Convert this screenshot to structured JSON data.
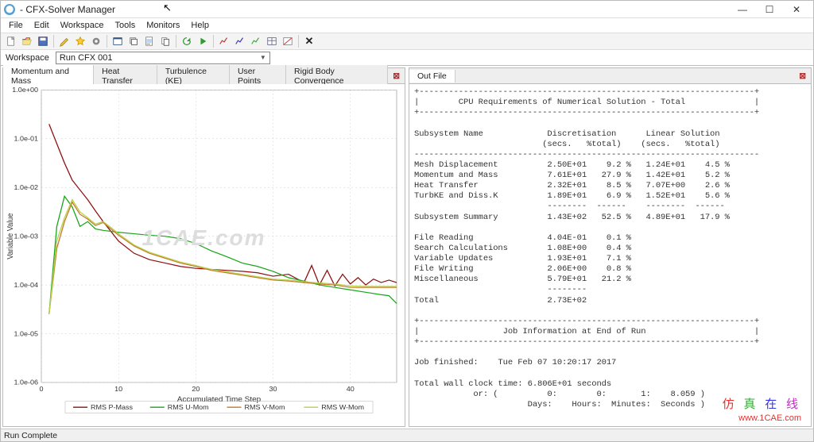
{
  "title": "- CFX-Solver Manager",
  "menus": [
    "File",
    "Edit",
    "Workspace",
    "Tools",
    "Monitors",
    "Help"
  ],
  "workspace": {
    "label": "Workspace",
    "value": "Run CFX 001"
  },
  "tabs": {
    "chart": [
      "Momentum and Mass",
      "Heat Transfer",
      "Turbulence (KE)",
      "User Points",
      "Rigid Body Convergence"
    ],
    "out": "Out File"
  },
  "status": "Run Complete",
  "chart_data": {
    "type": "line",
    "xlabel": "Accumulated Time Step",
    "ylabel": "Variable Value",
    "xlim": [
      0,
      46
    ],
    "ylim_log": [
      -6,
      0
    ],
    "x_ticks": [
      0,
      10,
      20,
      30,
      40
    ],
    "y_labels": [
      "1.0e+00",
      "1.0e-01",
      "1.0e-02",
      "1.0e-03",
      "1.0e-04",
      "1.0e-05",
      "1.0e-06"
    ],
    "series": [
      {
        "name": "RMS P-Mass",
        "color": "#8e0f10",
        "values": [
          [
            1,
            -0.7
          ],
          [
            2,
            -1.1
          ],
          [
            3,
            -1.5
          ],
          [
            4,
            -1.85
          ],
          [
            5,
            -2.05
          ],
          [
            6,
            -2.25
          ],
          [
            7,
            -2.48
          ],
          [
            8,
            -2.7
          ],
          [
            9,
            -2.9
          ],
          [
            10,
            -3.1
          ],
          [
            12,
            -3.35
          ],
          [
            14,
            -3.48
          ],
          [
            16,
            -3.55
          ],
          [
            18,
            -3.62
          ],
          [
            20,
            -3.66
          ],
          [
            22,
            -3.68
          ],
          [
            24,
            -3.7
          ],
          [
            26,
            -3.72
          ],
          [
            28,
            -3.75
          ],
          [
            30,
            -3.82
          ],
          [
            32,
            -3.78
          ],
          [
            34,
            -3.95
          ],
          [
            35,
            -3.6
          ],
          [
            36,
            -4.0
          ],
          [
            37,
            -3.7
          ],
          [
            38,
            -4.02
          ],
          [
            39,
            -3.78
          ],
          [
            40,
            -3.98
          ],
          [
            41,
            -3.85
          ],
          [
            42,
            -4.0
          ],
          [
            43,
            -3.88
          ],
          [
            44,
            -3.95
          ],
          [
            45,
            -3.9
          ],
          [
            46,
            -3.95
          ]
        ]
      },
      {
        "name": "RMS U-Mom",
        "color": "#1aa51a",
        "values": [
          [
            1,
            -4.6
          ],
          [
            2,
            -2.8
          ],
          [
            3,
            -2.18
          ],
          [
            4,
            -2.4
          ],
          [
            5,
            -2.8
          ],
          [
            6,
            -2.7
          ],
          [
            7,
            -2.85
          ],
          [
            8,
            -2.88
          ],
          [
            10,
            -2.92
          ],
          [
            12,
            -2.95
          ],
          [
            14,
            -2.98
          ],
          [
            16,
            -3.0
          ],
          [
            18,
            -3.05
          ],
          [
            20,
            -3.15
          ],
          [
            22,
            -3.3
          ],
          [
            24,
            -3.42
          ],
          [
            26,
            -3.55
          ],
          [
            28,
            -3.62
          ],
          [
            30,
            -3.72
          ],
          [
            32,
            -3.85
          ],
          [
            34,
            -3.92
          ],
          [
            36,
            -4.0
          ],
          [
            38,
            -4.05
          ],
          [
            40,
            -4.1
          ],
          [
            42,
            -4.15
          ],
          [
            44,
            -4.2
          ],
          [
            45,
            -4.22
          ],
          [
            46,
            -4.38
          ]
        ]
      },
      {
        "name": "RMS V-Mom",
        "color": "#c77825",
        "values": [
          [
            1,
            -4.6
          ],
          [
            2,
            -3.25
          ],
          [
            3,
            -2.7
          ],
          [
            4,
            -2.3
          ],
          [
            5,
            -2.55
          ],
          [
            6,
            -2.65
          ],
          [
            7,
            -2.78
          ],
          [
            8,
            -2.72
          ],
          [
            9,
            -2.85
          ],
          [
            10,
            -2.98
          ],
          [
            12,
            -3.2
          ],
          [
            14,
            -3.35
          ],
          [
            16,
            -3.45
          ],
          [
            18,
            -3.55
          ],
          [
            20,
            -3.62
          ],
          [
            22,
            -3.7
          ],
          [
            24,
            -3.75
          ],
          [
            26,
            -3.8
          ],
          [
            28,
            -3.85
          ],
          [
            30,
            -3.9
          ],
          [
            32,
            -3.92
          ],
          [
            34,
            -3.95
          ],
          [
            36,
            -3.98
          ],
          [
            38,
            -4.0
          ],
          [
            40,
            -4.05
          ],
          [
            42,
            -4.05
          ],
          [
            44,
            -4.05
          ],
          [
            46,
            -4.05
          ]
        ]
      },
      {
        "name": "RMS W-Mom",
        "color": "#b7d24a",
        "values": [
          [
            1,
            -4.6
          ],
          [
            2,
            -3.1
          ],
          [
            3,
            -2.62
          ],
          [
            4,
            -2.25
          ],
          [
            5,
            -2.5
          ],
          [
            6,
            -2.62
          ],
          [
            7,
            -2.75
          ],
          [
            8,
            -2.7
          ],
          [
            9,
            -2.82
          ],
          [
            10,
            -2.95
          ],
          [
            12,
            -3.18
          ],
          [
            14,
            -3.33
          ],
          [
            16,
            -3.43
          ],
          [
            18,
            -3.53
          ],
          [
            20,
            -3.6
          ],
          [
            22,
            -3.68
          ],
          [
            24,
            -3.73
          ],
          [
            26,
            -3.78
          ],
          [
            28,
            -3.83
          ],
          [
            30,
            -3.88
          ],
          [
            32,
            -3.9
          ],
          [
            34,
            -3.93
          ],
          [
            36,
            -3.96
          ],
          [
            38,
            -3.98
          ],
          [
            40,
            -4.02
          ],
          [
            42,
            -4.03
          ],
          [
            44,
            -4.03
          ],
          [
            46,
            -4.03
          ]
        ]
      }
    ]
  },
  "outfile": "+--------------------------------------------------------------------+\n|        CPU Requirements of Numerical Solution - Total              |\n+--------------------------------------------------------------------+\n\nSubsystem Name             Discretisation      Linear Solution\n                          (secs.   %total)    (secs.   %total)\n----------------------------------------------------------------------\nMesh Displacement          2.50E+01    9.2 %   1.24E+01    4.5 %\nMomentum and Mass          7.61E+01   27.9 %   1.42E+01    5.2 %\nHeat Transfer              2.32E+01    8.5 %   7.07E+00    2.6 %\nTurbKE and Diss.K          1.89E+01    6.9 %   1.52E+01    5.6 %\n                           --------  ------    --------  ------\nSubsystem Summary          1.43E+02   52.5 %   4.89E+01   17.9 %\n\nFile Reading               4.04E-01    0.1 %\nSearch Calculations        1.08E+00    0.4 %\nVariable Updates           1.93E+01    7.1 %\nFile Writing               2.06E+00    0.8 %\nMiscellaneous              5.79E+01   21.2 %\n                           --------\nTotal                      2.73E+02\n\n+--------------------------------------------------------------------+\n|                 Job Information at End of Run                      |\n+--------------------------------------------------------------------+\n\nJob finished:    Tue Feb 07 10:20:17 2017\n\nTotal wall clock time: 6.806E+01 seconds\n            or: (          0:        0:       1:    8.059 )\n                       Days:    Hours:  Minutes:  Seconds )\n\n\n--> Final synchronisation point reached by all partitions.\nEnd of solution stage.\n\n+--------------------------------------------------------------------+\n| The results from this run of the ANSYS CFX Solver have been       |\n| written to                                                         |\n| C:/Users/40534/AppData/Local/Temp/WB_DESKTOP-OLC8890_40534_7948_2- |\n| /unsaved_project_pending/dp0_CFX_Solution/CFX_001.res              |\n+--------------------------------------------------------------------+\n\n\n+--------------------------------------------------------------------+\n| For CFX runs launched from Workbench, the final locations of      |\n| directories and files generated may differ from those shown.      |\n+--------------------------------------------------------------------+\n\n\nThis run of the ANSYS CFX Solver has finished.",
  "watermark": {
    "brand_chars": [
      "仿",
      "真",
      "在",
      "线"
    ],
    "url": "www.1CAE.com",
    "chart_text": "1CAE.com"
  }
}
